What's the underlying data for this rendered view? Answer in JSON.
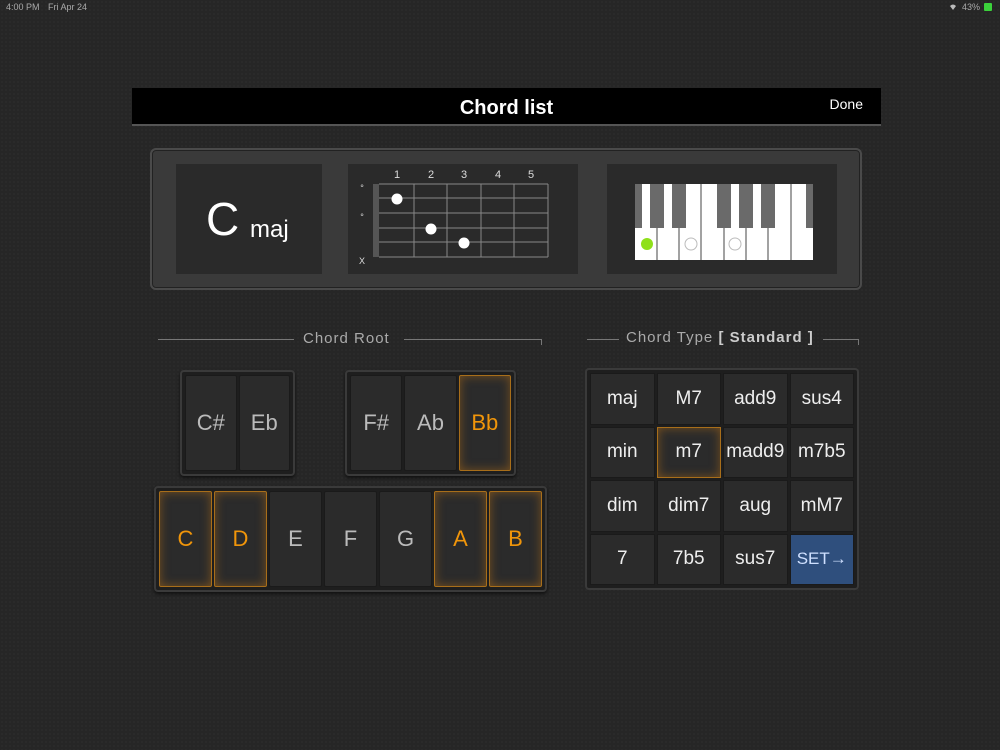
{
  "status": {
    "time": "4:00 PM",
    "date": "Fri Apr 24",
    "battery": "43%"
  },
  "header": {
    "title": "Chord list",
    "done_label": "Done"
  },
  "preview": {
    "root": "C",
    "type": "maj",
    "fret_numbers": [
      "1",
      "2",
      "3",
      "4",
      "5"
    ],
    "string_marks": [
      "°",
      "°",
      "X"
    ]
  },
  "root_section": {
    "label": "Chord Root",
    "sharps_left": [
      {
        "label": "C#",
        "active": false
      },
      {
        "label": "Eb",
        "active": false
      }
    ],
    "sharps_right": [
      {
        "label": "F#",
        "active": false
      },
      {
        "label": "Ab",
        "active": false
      },
      {
        "label": "Bb",
        "active": true
      }
    ],
    "naturals": [
      {
        "label": "C",
        "active": true
      },
      {
        "label": "D",
        "active": true
      },
      {
        "label": "E",
        "active": false
      },
      {
        "label": "F",
        "active": false
      },
      {
        "label": "G",
        "active": false
      },
      {
        "label": "A",
        "active": true
      },
      {
        "label": "B",
        "active": true
      }
    ]
  },
  "type_section": {
    "label": "Chord Type",
    "mode": "[ Standard ]",
    "buttons": [
      "maj",
      "M7",
      "add9",
      "sus4",
      "min",
      "m7",
      "madd9",
      "m7b5",
      "dim",
      "dim7",
      "aug",
      "mM7",
      "7",
      "7b5",
      "sus7",
      "SET→"
    ],
    "active_index": 5
  },
  "colors": {
    "accent": "#f0950a",
    "set_button": "#2f4f7d",
    "root_note_dot": "#8fe01a"
  }
}
